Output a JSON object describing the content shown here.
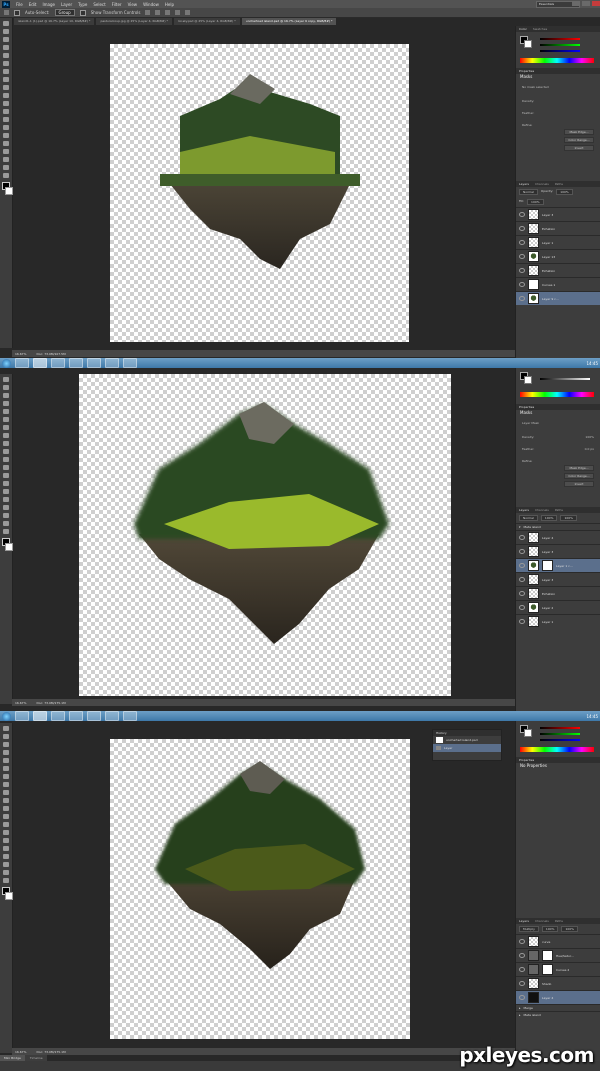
{
  "app": {
    "logo": "Ps",
    "menu": [
      "File",
      "Edit",
      "Image",
      "Layer",
      "Type",
      "Select",
      "Filter",
      "View",
      "Window",
      "Help"
    ],
    "workspace": "Essentials",
    "options": {
      "auto_select": "Auto-Select:",
      "auto_select_value": "Group",
      "transform": "Show Transform Controls"
    }
  },
  "shot1": {
    "tabs": [
      "island1-1 (1).psd @ 16.7% (Layer 10, RGB/8#) *",
      "pasturalcoup.jpg @ 25% (Layer 4, RGB/8#) *",
      "lol-sky.psd @ 25% (Layer 4, RGB/8#) *",
      "unchartoed island.psd @ 16.7% (Layer 9 copy, RGB/8#) *"
    ],
    "zoom": "16.67%",
    "doc": "Doc: 73.0M/107.5M",
    "panels": {
      "color_tabs": [
        "Color",
        "Swatches"
      ],
      "properties_title": "Properties",
      "masks_label": "Masks",
      "no_mask": "No mask selected",
      "density": "Density:",
      "feather": "Feather:",
      "refine": "Refine:",
      "buttons": [
        "Mask Edge...",
        "Color Range...",
        "Invert"
      ],
      "layers_tabs": [
        "Layers",
        "Channels",
        "Paths"
      ],
      "blend": "Normal",
      "opacity_label": "Opacity:",
      "opacity": "100%",
      "fill_label": "Fill:",
      "fill": "100%",
      "layers": [
        "Layer 3",
        "Exhation",
        "Layer 1",
        "Layer 13",
        "Exhation",
        "Curves 1",
        "Layer 9 c..."
      ]
    }
  },
  "shot2": {
    "zoom": "16.67%",
    "doc": "Doc: 73.0M/175.1M",
    "panels": {
      "properties_title": "Properties",
      "masks_label": "Masks",
      "layer_mask": "Layer Mask",
      "density_label": "Density:",
      "density": "100%",
      "feather_label": "Feather:",
      "feather": "0.0 px",
      "refine": "Refine:",
      "buttons": [
        "Mask Edge...",
        "Color Range...",
        "Invert"
      ],
      "layers_tabs": [
        "Layers",
        "Channels",
        "Paths"
      ],
      "blend": "Normal",
      "opacity": "100%",
      "fill": "100%",
      "group": "Meta island",
      "layers": [
        "Layer 4",
        "Layer 3",
        "Layer 1 c...",
        "Layer 3",
        "Exhation",
        "Layer 2",
        "Layer 1"
      ]
    }
  },
  "shot3": {
    "zoom": "16.67%",
    "doc": "Doc: 73.0M/175.1M",
    "history_title": "History",
    "history_items": [
      "uncharted island.psd",
      "Layer"
    ],
    "panels": {
      "properties_title": "Properties",
      "no_properties": "No Properties",
      "layers_tabs": [
        "Layers",
        "Channels",
        "Paths"
      ],
      "blend": "Multiply",
      "opacity": "100%",
      "fill": "100%",
      "layers": [
        "curve",
        "Hue/Satur...",
        "Curves 2",
        "Shado",
        "Layer 4",
        "Merge",
        "Meta island"
      ]
    }
  },
  "bottom_tabs": [
    "Mini Bridge",
    "Timeline"
  ],
  "taskbar_clock": [
    "14:45",
    "14:45"
  ],
  "watermark": "pxleyes.com",
  "colors": {
    "accent": "#5b6f8c",
    "chrome": "#535353",
    "canvas_bg": "#282828",
    "taskbar": "#3e78a8"
  }
}
